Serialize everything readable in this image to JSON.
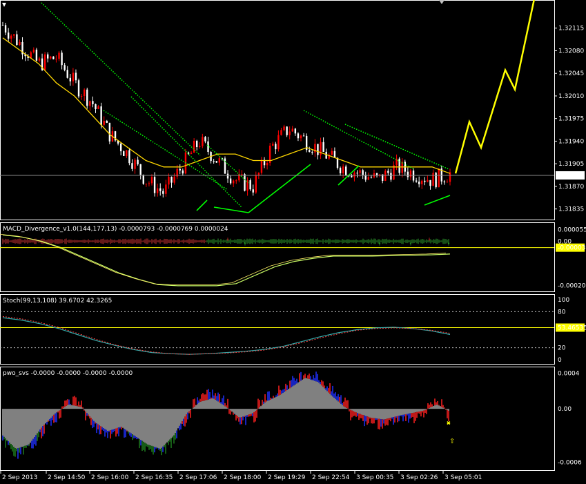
{
  "colors": {
    "background": "#000000",
    "frame": "#ffffff",
    "bull_candle": "#ff0000",
    "bear_candle": "#ffffff",
    "ma_line": "#ffd700",
    "trend_line": "#00ff00",
    "projection": "#ffff00",
    "macd_main": "#ccff66",
    "stoch_main": "#33aaaa",
    "stoch_signal": "#ff4444",
    "pwo_pos": "#ff2020",
    "pwo_neg": "#2030ff",
    "pwo_green": "#1d7a1d",
    "pwo_hist": "#ffffff",
    "level_highlight": "#ffff00"
  },
  "chart_data": [
    {
      "type": "line",
      "panel": "price",
      "title": "",
      "y_ticks": [
        "1.32115",
        "1.32080",
        "1.32045",
        "1.32010",
        "1.31975",
        "1.31940",
        "1.31905",
        "1.31870",
        "1.31835"
      ],
      "ylim": [
        1.31825,
        1.3215
      ],
      "current_price": "1.31887",
      "x_tick_labels": [
        "2 Sep 2013",
        "2 Sep 14:50",
        "2 Sep 16:00",
        "2 Sep 16:35",
        "2 Sep 17:06",
        "2 Sep 18:00",
        "2 Sep 19:29",
        "2 Sep 22:54",
        "3 Sep 00:35",
        "3 Sep 02:26",
        "3 Sep 05:01"
      ],
      "series": [
        {
          "values": [
            1.3212,
            1.3209,
            1.3206,
            1.3207,
            1.3203,
            1.32,
            1.3195,
            1.3192,
            1.3188,
            1.3186,
            1.319,
            1.3194,
            1.3191,
            1.3188,
            1.3187,
            1.3193,
            1.3196,
            1.3194,
            1.3192,
            1.319,
            1.3189,
            1.3188,
            1.319,
            1.3189,
            1.3188,
            1.3189
          ]
        },
        {
          "values": [
            1.321,
            1.3208,
            1.3206,
            1.3203,
            1.3201,
            1.3198,
            1.3195,
            1.3193,
            1.3191,
            1.319,
            1.319,
            1.3191,
            1.3192,
            1.3192,
            1.3191,
            1.3191,
            1.3192,
            1.3193,
            1.3192,
            1.3191,
            1.319,
            1.319,
            1.319,
            1.319,
            1.319,
            1.3189
          ]
        },
        {
          "values": [
            1.3189,
            1.3197,
            1.3193,
            1.3205,
            1.3202,
            1.3218
          ]
        }
      ]
    },
    {
      "type": "line",
      "panel": "macd",
      "title": "MACD_Divergence_v1.0(144,177,13) -0.0000793 -0.0000769 0.0000024",
      "y_ticks": [
        "0.000055",
        "0.00",
        "-0.000208"
      ],
      "highlight_label": "-0.00003",
      "ylim": [
        -0.00023,
        7e-05
      ],
      "series": [
        {
          "values": [
            3e-05,
            2e-05,
            0.0,
            -3e-05,
            -7e-05,
            -0.00011,
            -0.00015,
            -0.00018,
            -0.000205,
            -0.00021,
            -0.00021,
            -0.00021,
            -0.0002,
            -0.00016,
            -0.00012,
            -9.5e-05,
            -8e-05,
            -7e-05,
            -7e-05,
            -7e-05,
            -6.8e-05,
            -6.6e-05,
            -6.4e-05,
            -6e-05
          ]
        }
      ]
    },
    {
      "type": "line",
      "panel": "stoch",
      "title": "Stoch(99,13,108) 39.6702 42.3265",
      "y_ticks": [
        "100",
        "80",
        "20",
        "0"
      ],
      "highlight_label": "53.46535",
      "ylim": [
        0,
        100
      ],
      "levels": [
        80,
        20
      ],
      "current_level": 53.46535,
      "series": [
        {
          "name": "",
          "values": [
            70,
            66,
            60,
            52,
            42,
            32,
            24,
            17,
            12,
            10,
            9,
            10,
            12,
            14,
            17,
            22,
            30,
            38,
            45,
            50,
            53,
            54,
            52,
            48,
            42
          ]
        },
        {
          "name": "",
          "values": [
            72,
            68,
            62,
            54,
            44,
            34,
            25,
            18,
            13,
            10,
            9,
            10,
            11,
            13,
            16,
            21,
            28,
            36,
            43,
            49,
            52,
            53,
            52,
            49,
            44
          ]
        }
      ]
    },
    {
      "type": "bar",
      "panel": "pwo",
      "title": "pwo_svs -0.0000 -0.0000 -0.0000 -0.0000",
      "y_ticks": [
        "0.0004",
        "0.00",
        "-0.0006"
      ],
      "ylim": [
        -0.00065,
        0.00042
      ],
      "values": [
        -0.0003,
        -0.00045,
        -0.0004,
        -0.0002,
        -5e-05,
        5e-05,
        2e-05,
        -0.00015,
        -0.00025,
        -0.0002,
        -0.0003,
        -0.0004,
        -0.00045,
        -0.0003,
        -5e-05,
        8e-05,
        0.00012,
        2e-05,
        -0.0001,
        -5e-05,
        8e-05,
        0.00015,
        0.00025,
        0.00035,
        0.0003,
        0.00015,
        2e-05,
        -5e-05,
        -0.0001,
        -0.00012,
        -8e-05,
        -5e-05,
        -2e-05,
        5e-05,
        -3e-05
      ]
    }
  ]
}
